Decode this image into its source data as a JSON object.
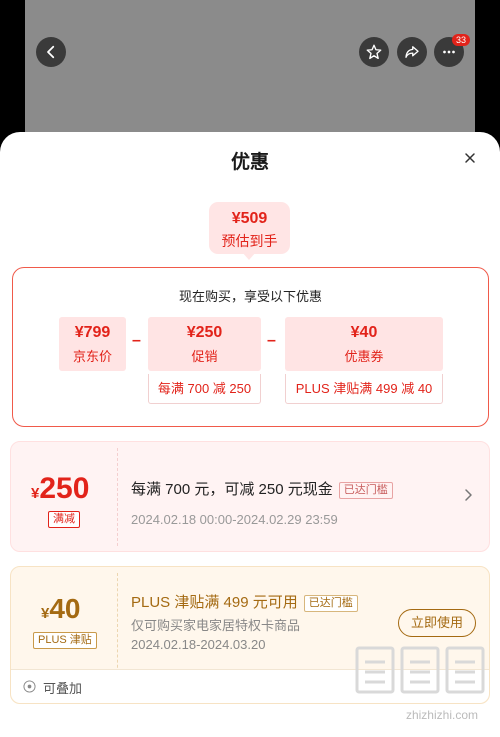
{
  "top_bar": {
    "more_badge_count": "33",
    "icons": [
      "back-icon",
      "star-icon",
      "share-icon",
      "more-icon"
    ]
  },
  "sheet": {
    "title": "优惠",
    "estimate": {
      "price": "¥509",
      "label": "预估到手"
    },
    "calc": {
      "title": "现在购买，享受以下优惠",
      "items": [
        {
          "value": "¥799",
          "label": "京东价"
        },
        {
          "value": "¥250",
          "label": "促销",
          "note": "每满 700 减 250"
        },
        {
          "value": "¥40",
          "label": "优惠券",
          "note": "PLUS 津贴满 499 减 40"
        }
      ],
      "op_minus": "–"
    },
    "promo": {
      "currency": "¥",
      "amount": "250",
      "tag": "满减",
      "text": "每满 700 元，可减 250 元现金",
      "reached": "已达门槛",
      "date": "2024.02.18 00:00-2024.02.29 23:59"
    },
    "coupon": {
      "currency": "¥",
      "amount": "40",
      "tag": "PLUS 津贴",
      "text": "PLUS 津贴满 499 元可用",
      "reached": "已达门槛",
      "sub": "仅可购买家电家居特权卡商品",
      "date": "2024.02.18-2024.03.20",
      "button": "立即使用",
      "stackable": "可叠加"
    }
  },
  "watermark": {
    "logo": "值",
    "url": "zhizhizhi.com"
  },
  "colors": {
    "accent": "#e2231a",
    "gold": "#a46a12"
  }
}
